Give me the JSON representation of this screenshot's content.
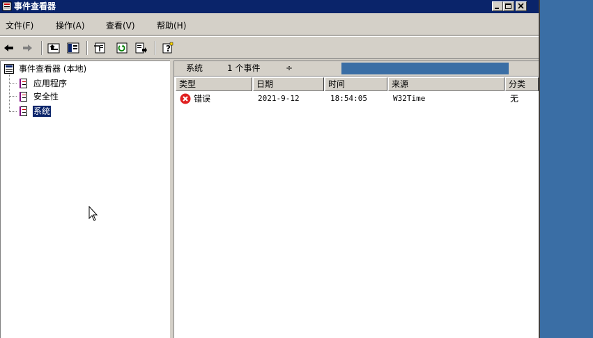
{
  "window": {
    "title": "事件查看器"
  },
  "menu": {
    "items": [
      "文件(F)",
      "操作(A)",
      "查看(V)",
      "帮助(H)"
    ]
  },
  "tree": {
    "root": "事件查看器 (本地)",
    "children": [
      "应用程序",
      "安全性",
      "系统"
    ],
    "selected": "系统"
  },
  "infobar": {
    "log_name": "系统",
    "event_count": "1 个事件",
    "sort_marker": "÷"
  },
  "columns": [
    "类型",
    "日期",
    "时间",
    "来源",
    "分类"
  ],
  "events": [
    {
      "type": "错误",
      "date": "2021-9-12",
      "time": "18:54:05",
      "source": "W32Time",
      "category": "无"
    }
  ],
  "colors": {
    "title_bar": "#0a246a",
    "desktop": "#3a6ea5",
    "chrome": "#d4d0c8",
    "error_red": "#e02020"
  }
}
